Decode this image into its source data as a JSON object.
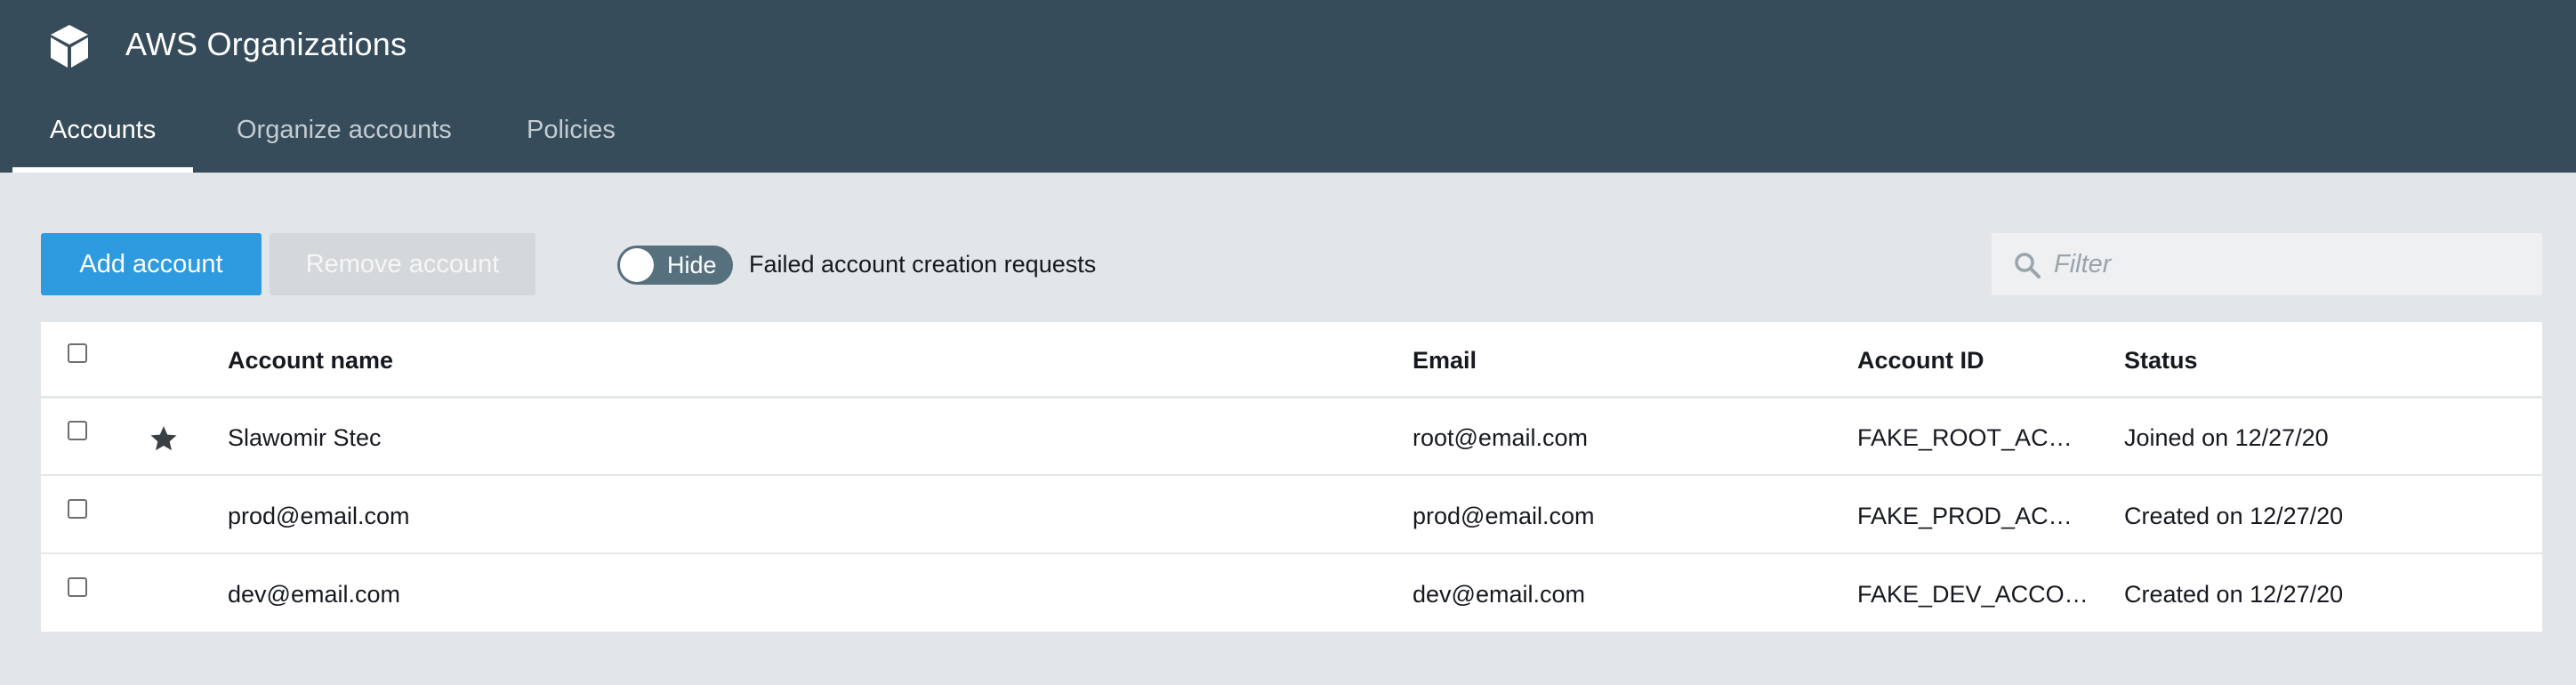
{
  "header": {
    "app_title": "AWS Organizations",
    "logo_icon": "cube-icon",
    "tabs": [
      {
        "label": "Accounts",
        "active": true
      },
      {
        "label": "Organize accounts",
        "active": false
      },
      {
        "label": "Policies",
        "active": false
      }
    ]
  },
  "toolbar": {
    "add_label": "Add account",
    "remove_label": "Remove account",
    "toggle_label": "Hide",
    "toggle_description": "Failed account creation requests",
    "filter_placeholder": "Filter"
  },
  "table": {
    "columns": [
      "Account name",
      "Email",
      "Account ID",
      "Status"
    ],
    "rows": [
      {
        "name": "Slawomir Stec",
        "email": "root@email.com",
        "account_id": "FAKE_ROOT_AC…",
        "status": "Joined on 12/27/20",
        "starred": true
      },
      {
        "name": "prod@email.com",
        "email": "prod@email.com",
        "account_id": "FAKE_PROD_AC…",
        "status": "Created on 12/27/20",
        "starred": false
      },
      {
        "name": "dev@email.com",
        "email": "dev@email.com",
        "account_id": "FAKE_DEV_ACCO…",
        "status": "Created on 12/27/20",
        "starred": false
      }
    ]
  },
  "colors": {
    "header_bg": "#374c5b",
    "primary": "#2e9ae0",
    "page_bg": "#e2e6e8"
  }
}
